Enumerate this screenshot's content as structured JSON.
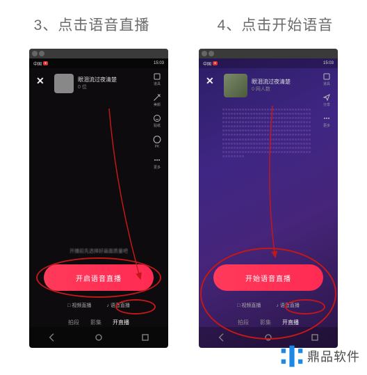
{
  "captions": {
    "step3": "3、点击语音直播",
    "step4": "4、点击开始语音"
  },
  "left": {
    "close": "✕",
    "host_name": "眼泪流过夜清楚",
    "host_sub": "0 位",
    "side": [
      "道具",
      "美颜",
      "贴纸",
      "PK",
      "更多"
    ],
    "hint": "开播前先选择好画面质量吧",
    "cta": "开启语音直播",
    "modes": {
      "video": "视频直播",
      "voice": "语音直播"
    },
    "tabs": {
      "t1": "拍段",
      "t2": "影集",
      "t3": "开直播"
    }
  },
  "right": {
    "close": "✕",
    "host_name": "眼泪流过夜清楚",
    "host_sub": "0 网人数",
    "side": [
      "道具",
      "分享",
      "更多"
    ],
    "cta": "开始语音直播",
    "modes": {
      "video": "视频直播",
      "voice": "语音直播"
    },
    "tabs": {
      "t1": "拍段",
      "t2": "影集",
      "t3": "开直播"
    }
  },
  "statusbar": {
    "time": "15:03",
    "carrier": "中国"
  },
  "watermark": "鼎品软件"
}
